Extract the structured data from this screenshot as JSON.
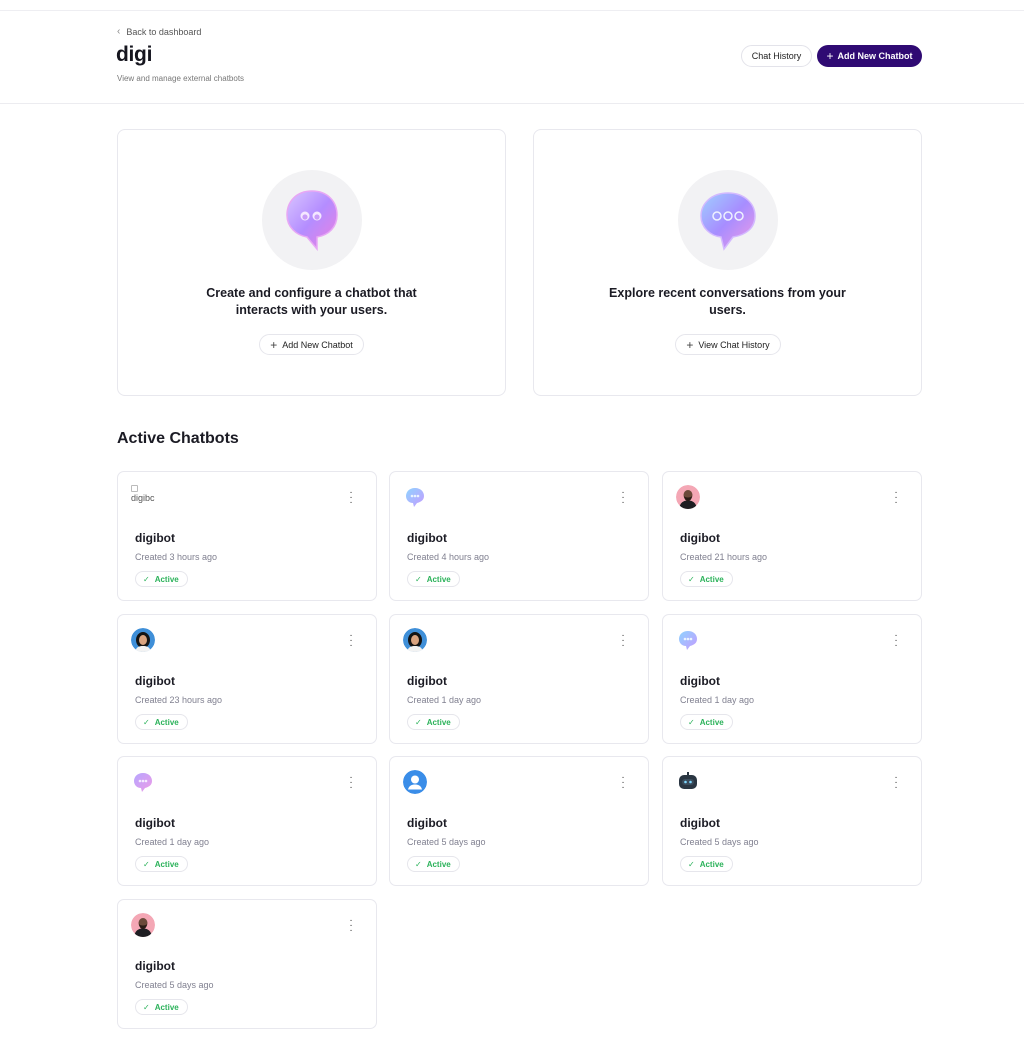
{
  "header": {
    "back_label": "Back to dashboard",
    "title": "digi",
    "subtitle": "View and manage external chatbots",
    "chat_history_label": "Chat History",
    "add_new_label": "Add New Chatbot"
  },
  "hero": {
    "create_text": "Create and configure a chatbot that interacts with your users.",
    "create_button": "Add New Chatbot",
    "explore_text": "Explore recent conversations from your users.",
    "explore_button": "View Chat History"
  },
  "section": {
    "title": "Active Chatbots"
  },
  "chatbots": [
    {
      "name": "digibot",
      "created": "Created 3 hours ago",
      "status": "Active",
      "avatar": "broken-image",
      "alt": "digibc"
    },
    {
      "name": "digibot",
      "created": "Created 4 hours ago",
      "status": "Active",
      "avatar": "bubble-icon"
    },
    {
      "name": "digibot",
      "created": "Created 21 hours ago",
      "status": "Active",
      "avatar": "man-photo"
    },
    {
      "name": "digibot",
      "created": "Created 23 hours ago",
      "status": "Active",
      "avatar": "woman-photo"
    },
    {
      "name": "digibot",
      "created": "Created 1 day ago",
      "status": "Active",
      "avatar": "woman-photo"
    },
    {
      "name": "digibot",
      "created": "Created 1 day ago",
      "status": "Active",
      "avatar": "bubble-icon"
    },
    {
      "name": "digibot",
      "created": "Created 1 day ago",
      "status": "Active",
      "avatar": "bubble-icon"
    },
    {
      "name": "digibot",
      "created": "Created 5 days ago",
      "status": "Active",
      "avatar": "user-icon"
    },
    {
      "name": "digibot",
      "created": "Created 5 days ago",
      "status": "Active",
      "avatar": "robot-icon"
    },
    {
      "name": "digibot",
      "created": "Created 5 days ago",
      "status": "Active",
      "avatar": "man-photo"
    }
  ],
  "colors": {
    "primary": "#2f0a73",
    "active_green": "#2bb25a",
    "border": "#e8e8ee"
  }
}
